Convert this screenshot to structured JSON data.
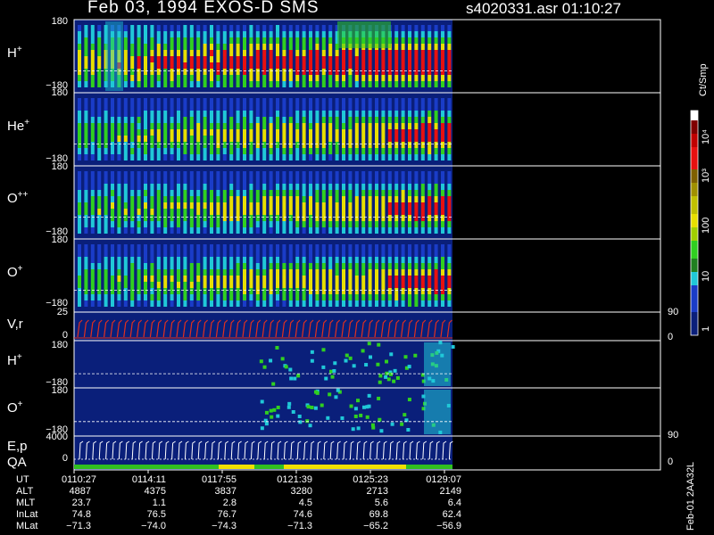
{
  "header": {
    "title": "Feb 03, 1994   EXOS-D SMS",
    "file_time": "s4020331.asr  01:10:27"
  },
  "panels": [
    {
      "label_base": "H",
      "label_sup": "+",
      "y_top": "180",
      "y_bottom": "−180"
    },
    {
      "label_base": "He",
      "label_sup": "+",
      "y_top": "180",
      "y_bottom": "−180"
    },
    {
      "label_base": "O",
      "label_sup": "++",
      "y_top": "180",
      "y_bottom": "−180"
    },
    {
      "label_base": "O",
      "label_sup": "+",
      "y_top": "180",
      "y_bottom": "−180"
    },
    {
      "label_base": "V,r",
      "label_sup": "",
      "y_top": "25",
      "y_bottom": "0",
      "r_top": "90",
      "r_bottom": "0"
    },
    {
      "label_base": "H",
      "label_sup": "+",
      "y_top": "180",
      "y_bottom": "−180"
    },
    {
      "label_base": "O",
      "label_sup": "+",
      "y_top": "180",
      "y_bottom": "−180"
    },
    {
      "label_base": "E,p",
      "label_sup": "",
      "label2": "QA",
      "y_top": "4000",
      "y_bottom": "0",
      "r_top": "90",
      "r_bottom": "0"
    }
  ],
  "colorbar": {
    "unit": "Ct/Smp",
    "ticks": [
      "10⁴",
      "10³",
      "100",
      "10",
      "1"
    ]
  },
  "time_axis": {
    "rows": [
      {
        "name": "UT",
        "values": [
          "0110:27",
          "0114:11",
          "0117:55",
          "0121:39",
          "0125:23",
          "0129:07"
        ]
      },
      {
        "name": "ALT",
        "values": [
          "4887",
          "4375",
          "3837",
          "3280",
          "2713",
          "2149"
        ]
      },
      {
        "name": "MLT",
        "values": [
          "23.7",
          "1.1",
          "2.8",
          "4.5",
          "5.6",
          "6.4"
        ]
      },
      {
        "name": "InLat",
        "values": [
          "74.8",
          "76.5",
          "76.7",
          "74.6",
          "69.8",
          "62.4"
        ]
      },
      {
        "name": "MLat",
        "values": [
          "−71.3",
          "−74.0",
          "−74.3",
          "−71.3",
          "−65.2",
          "−56.9"
        ]
      }
    ]
  },
  "stamp": "Feb-01 2AA32L",
  "chart_data": {
    "type": "heatmap",
    "title": "Feb 03, 1994   EXOS-D SMS",
    "x": [
      "0110:27",
      "0114:11",
      "0117:55",
      "0121:39",
      "0125:23",
      "0129:07"
    ],
    "xlabel": "UT",
    "series": [
      {
        "name": "H+",
        "ylim": [
          -180,
          180
        ]
      },
      {
        "name": "He+",
        "ylim": [
          -180,
          180
        ]
      },
      {
        "name": "O++",
        "ylim": [
          -180,
          180
        ]
      },
      {
        "name": "O+",
        "ylim": [
          -180,
          180
        ]
      },
      {
        "name": "V,r",
        "ylim": [
          0,
          25
        ]
      },
      {
        "name": "H+",
        "ylim": [
          -180,
          180
        ]
      },
      {
        "name": "O+",
        "ylim": [
          -180,
          180
        ]
      },
      {
        "name": "E,p",
        "ylim": [
          0,
          4000
        ]
      }
    ],
    "colorbar_unit": "Ct/Smp",
    "colors": {
      "background": "#0a1f7a",
      "low": "#1a3cc8",
      "cyan": "#20c8d8",
      "green": "#30d020",
      "yellow": "#e8e000",
      "red": "#e81010",
      "vr_trace": "#e03020",
      "qa_green": "#30c020",
      "qa_yellow": "#f0e000"
    }
  }
}
